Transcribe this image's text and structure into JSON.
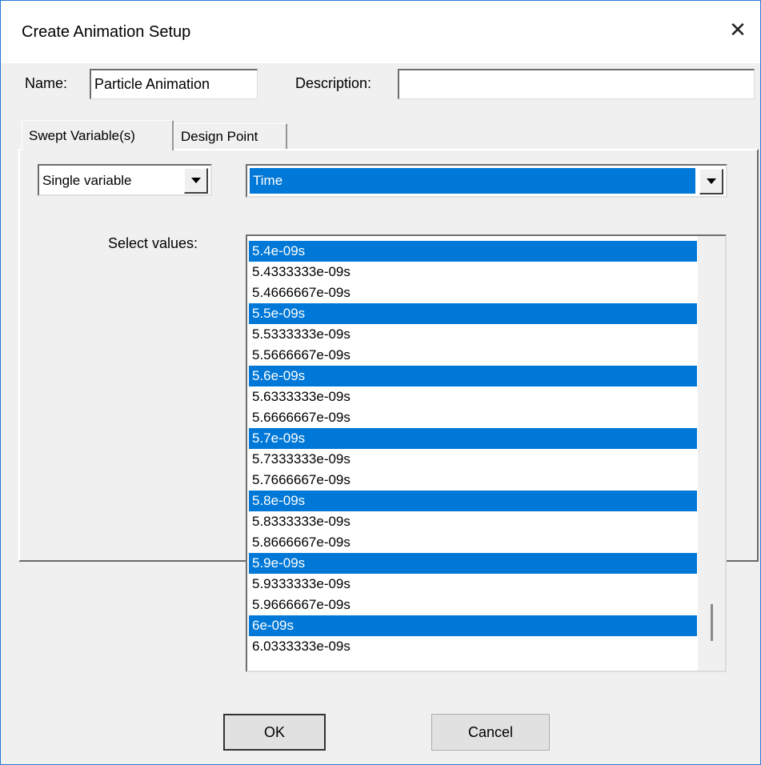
{
  "window": {
    "title": "Create Animation Setup",
    "close_glyph": "✕"
  },
  "name_field": {
    "label": "Name:",
    "value": "Particle Animation"
  },
  "description_field": {
    "label": "Description:",
    "value": ""
  },
  "tabs": [
    {
      "label": "Swept Variable(s)",
      "active": true
    },
    {
      "label": "Design Point",
      "active": false
    }
  ],
  "mode_select": {
    "value": "Single variable"
  },
  "variable_select": {
    "value": "Time"
  },
  "values_list": {
    "label": "Select values:",
    "items": [
      {
        "text": "5.4e-09s",
        "selected": true
      },
      {
        "text": "5.4333333e-09s",
        "selected": false
      },
      {
        "text": "5.4666667e-09s",
        "selected": false
      },
      {
        "text": "5.5e-09s",
        "selected": true
      },
      {
        "text": "5.5333333e-09s",
        "selected": false
      },
      {
        "text": "5.5666667e-09s",
        "selected": false
      },
      {
        "text": "5.6e-09s",
        "selected": true
      },
      {
        "text": "5.6333333e-09s",
        "selected": false
      },
      {
        "text": "5.6666667e-09s",
        "selected": false
      },
      {
        "text": "5.7e-09s",
        "selected": true
      },
      {
        "text": "5.7333333e-09s",
        "selected": false
      },
      {
        "text": "5.7666667e-09s",
        "selected": false
      },
      {
        "text": "5.8e-09s",
        "selected": true
      },
      {
        "text": "5.8333333e-09s",
        "selected": false
      },
      {
        "text": "5.8666667e-09s",
        "selected": false
      },
      {
        "text": "5.9e-09s",
        "selected": true
      },
      {
        "text": "5.9333333e-09s",
        "selected": false
      },
      {
        "text": "5.9666667e-09s",
        "selected": false
      },
      {
        "text": "6e-09s",
        "selected": true
      },
      {
        "text": "6.0333333e-09s",
        "selected": false
      }
    ]
  },
  "buttons": {
    "ok": "OK",
    "cancel": "Cancel"
  },
  "colors": {
    "selection": "#0078d7",
    "window_border": "#2b79d6",
    "face": "#f0f0f0"
  }
}
